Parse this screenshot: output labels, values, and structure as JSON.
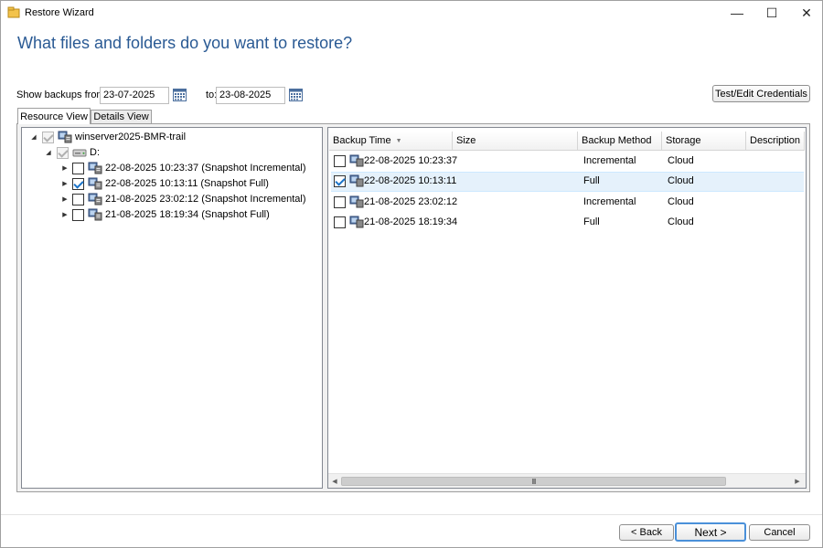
{
  "window": {
    "title": "Restore Wizard",
    "controls": {
      "minimize": "—",
      "maximize": "☐",
      "close": "✕"
    }
  },
  "heading": "What files and folders do you want to restore?",
  "filter": {
    "from_label": "Show backups from:",
    "from_value": "23-07-2025",
    "to_label": "to:",
    "to_value": "23-08-2025"
  },
  "credentials_button": "Test/Edit Credentials",
  "tabs": [
    {
      "label": "Resource View",
      "active": true
    },
    {
      "label": "Details View",
      "active": false
    }
  ],
  "tree": {
    "root": {
      "label": "winserver2025-BMR-trail",
      "icon": "server-icon"
    },
    "drive": {
      "label": "D:",
      "icon": "drive-icon"
    },
    "backups": [
      {
        "label": "22-08-2025 10:23:37 (Snapshot Incremental)",
        "checked": false
      },
      {
        "label": "22-08-2025 10:13:11 (Snapshot Full)",
        "checked": true
      },
      {
        "label": "21-08-2025 23:02:12 (Snapshot Incremental)",
        "checked": false
      },
      {
        "label": "21-08-2025 18:19:34 (Snapshot Full)",
        "checked": false
      }
    ]
  },
  "grid": {
    "columns": [
      "Backup Time",
      "Size",
      "Backup Method",
      "Storage",
      "Description"
    ],
    "sort_indicator": "▼",
    "rows": [
      {
        "time": "22-08-2025 10:23:37",
        "size": "",
        "method": "Incremental",
        "storage": "Cloud",
        "description": "",
        "checked": false,
        "selected": false
      },
      {
        "time": "22-08-2025 10:13:11",
        "size": "",
        "method": "Full",
        "storage": "Cloud",
        "description": "",
        "checked": true,
        "selected": true
      },
      {
        "time": "21-08-2025 23:02:12",
        "size": "",
        "method": "Incremental",
        "storage": "Cloud",
        "description": "",
        "checked": false,
        "selected": false
      },
      {
        "time": "21-08-2025 18:19:34",
        "size": "",
        "method": "Full",
        "storage": "Cloud",
        "description": "",
        "checked": false,
        "selected": false
      }
    ],
    "scroll_grip": "III"
  },
  "footer": {
    "back": "< Back",
    "next": "Next >",
    "cancel": "Cancel"
  },
  "colors": {
    "heading": "#2a5a94",
    "selection": "#e5f1fb",
    "focus_border": "#4a90d9"
  }
}
